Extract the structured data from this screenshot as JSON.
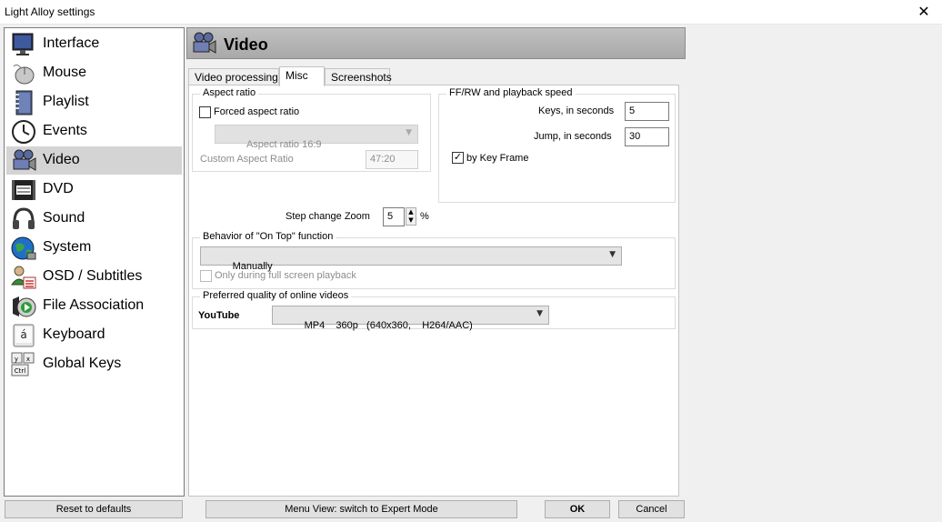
{
  "window": {
    "title": "Light Alloy settings",
    "close_glyph": "✕"
  },
  "sidebar": {
    "items": [
      {
        "label": "Interface",
        "icon": "monitor-icon"
      },
      {
        "label": "Mouse",
        "icon": "mouse-icon"
      },
      {
        "label": "Playlist",
        "icon": "notebook-icon"
      },
      {
        "label": "Events",
        "icon": "clock-icon"
      },
      {
        "label": "Video",
        "icon": "video-camera-icon",
        "active": true
      },
      {
        "label": "DVD",
        "icon": "dvd-icon"
      },
      {
        "label": "Sound",
        "icon": "headphones-icon"
      },
      {
        "label": "System",
        "icon": "globe-icon"
      },
      {
        "label": "OSD / Subtitles",
        "icon": "osd-subtitles-icon"
      },
      {
        "label": "File Association",
        "icon": "file-association-icon"
      },
      {
        "label": "Keyboard",
        "icon": "keyboard-key-icon"
      },
      {
        "label": "Global Keys",
        "icon": "global-keys-icon"
      }
    ]
  },
  "panel": {
    "title": "Video",
    "tabs": [
      {
        "label": "Video processing"
      },
      {
        "label": "Misc",
        "active": true
      },
      {
        "label": "Screenshots"
      }
    ]
  },
  "aspect": {
    "group_label": "Aspect ratio",
    "forced_label": "Forced aspect ratio",
    "forced_checked": false,
    "combo_value": "Aspect ratio 16:9",
    "custom_label": "Custom Aspect Ratio",
    "custom_value": "47:20"
  },
  "zoom": {
    "label": "Step change Zoom",
    "value": "5",
    "unit": "%"
  },
  "ffrw": {
    "group_label": "FF/RW and playback speed",
    "keys_label": "Keys, in seconds",
    "keys_value": "5",
    "jump_label": "Jump, in seconds",
    "jump_value": "30",
    "keyframe_label": "by Key Frame",
    "keyframe_checked": true
  },
  "ontop": {
    "group_label": "Behavior of \"On Top\" function",
    "combo_value": "Manually",
    "fullscreen_label": "Only during full screen playback",
    "fullscreen_checked": false
  },
  "online": {
    "group_label": "Preferred quality of online videos",
    "service_label": "YouTube",
    "combo_value": "MP4    360p   (640x360,    H264/AAC)"
  },
  "buttons": {
    "reset": "Reset to defaults",
    "expert": "Menu View: switch to Expert Mode",
    "ok": "OK",
    "cancel": "Cancel"
  },
  "glyphs": {
    "check": "✓",
    "down_arrow": "▼",
    "up_arrow": "▲"
  },
  "colors": {
    "active_item_bg": "#d4d4d4",
    "header_bg": "#b4b4b4",
    "window_bg": "#f0f0f0"
  }
}
